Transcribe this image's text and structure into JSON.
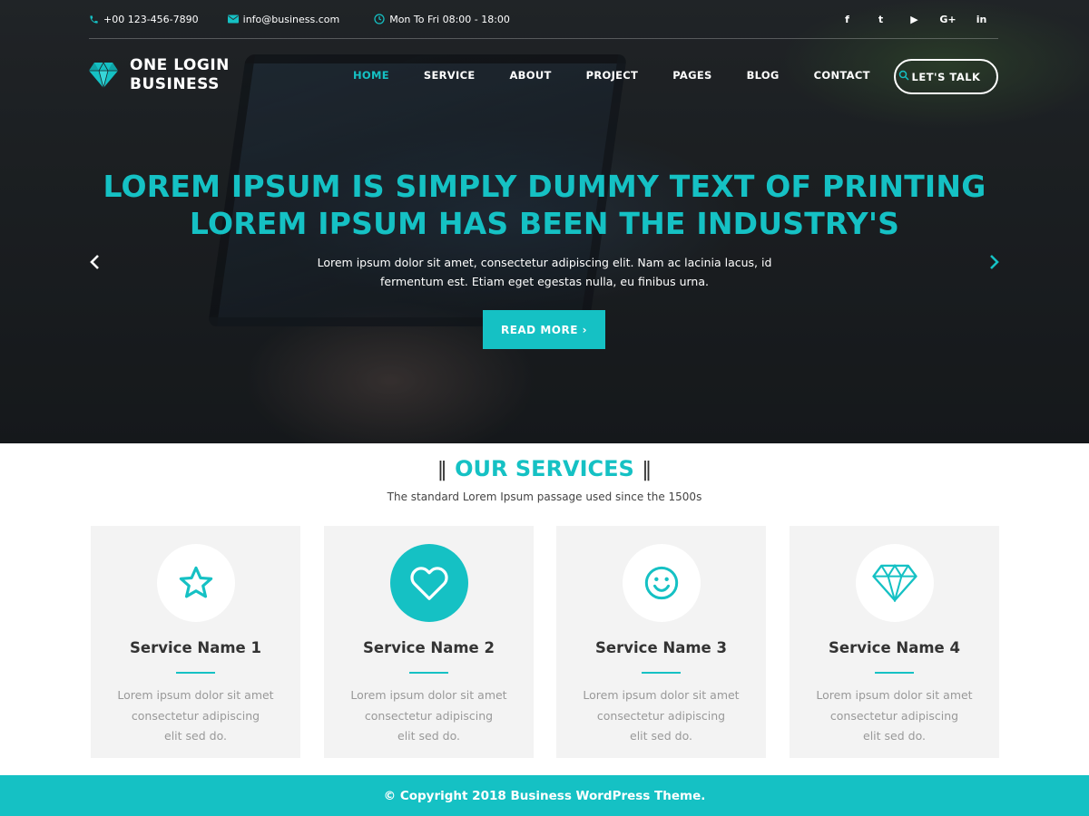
{
  "topbar": {
    "phone": "+00 123-456-7890",
    "email": "info@business.com",
    "hours": "Mon To Fri 08:00 - 18:00",
    "social": [
      {
        "icon": "facebook-icon",
        "glyph": "f"
      },
      {
        "icon": "twitter-icon",
        "glyph": "t"
      },
      {
        "icon": "youtube-icon",
        "glyph": "▶"
      },
      {
        "icon": "google-plus-icon",
        "glyph": "G+"
      },
      {
        "icon": "linkedin-icon",
        "glyph": "in"
      }
    ]
  },
  "brand": {
    "line1": "ONE LOGIN",
    "line2": "BUSINESS"
  },
  "nav": {
    "items": [
      {
        "label": "HOME",
        "active": true
      },
      {
        "label": "SERVICE"
      },
      {
        "label": "ABOUT"
      },
      {
        "label": "PROJECT"
      },
      {
        "label": "PAGES"
      },
      {
        "label": "BLOG"
      },
      {
        "label": "CONTACT"
      }
    ],
    "cta": "LET'S TALK"
  },
  "hero": {
    "headline_1": "LOREM IPSUM IS SIMPLY DUMMY TEXT OF PRINTING",
    "headline_2": "LOREM IPSUM HAS BEEN THE INDUSTRY'S",
    "lead_1": "Lorem ipsum dolor sit amet, consectetur adipiscing elit. Nam ac lacinia lacus, id",
    "lead_2": "fermentum est. Etiam eget egestas nulla, eu finibus urna.",
    "button": "READ MORE ›"
  },
  "services": {
    "title": "OUR SERVICES",
    "subtitle": "The standard Lorem Ipsum passage used since the 1500s",
    "items": [
      {
        "name": "Service Name 1",
        "icon": "star-icon",
        "desc": "Lorem ipsum dolor sit amet\nconsectetur adipiscing\nelit sed do."
      },
      {
        "name": "Service Name 2",
        "icon": "heart-icon",
        "desc": "Lorem ipsum dolor sit amet\nconsectetur adipiscing\nelit sed do."
      },
      {
        "name": "Service Name 3",
        "icon": "smiley-icon",
        "desc": "Lorem ipsum dolor sit amet\nconsectetur adipiscing\nelit sed do."
      },
      {
        "name": "Service Name 4",
        "icon": "diamond-icon",
        "desc": "Lorem ipsum dolor sit amet\nconsectetur adipiscing\nelit sed do."
      }
    ]
  },
  "footer": {
    "text": "© Copyright 2018 Business WordPress Theme."
  },
  "colors": {
    "accent": "#15c1c4",
    "card_bg": "#f3f3f3",
    "dark_text": "#333333"
  }
}
